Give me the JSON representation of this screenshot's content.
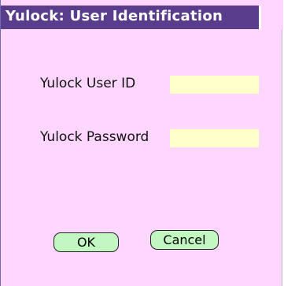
{
  "dialog": {
    "title": "Yulock: User Identification"
  },
  "form": {
    "user_id_label": "Yulock User ID",
    "user_id_value": "",
    "password_label": "Yulock Password",
    "password_value": ""
  },
  "buttons": {
    "ok_label": "OK",
    "cancel_label": "Cancel"
  },
  "colors": {
    "background": "#ffd6ff",
    "title_bar": "#5a3c8c",
    "input_fill": "#ffffcc",
    "button_fill": "#c2f7c2"
  }
}
